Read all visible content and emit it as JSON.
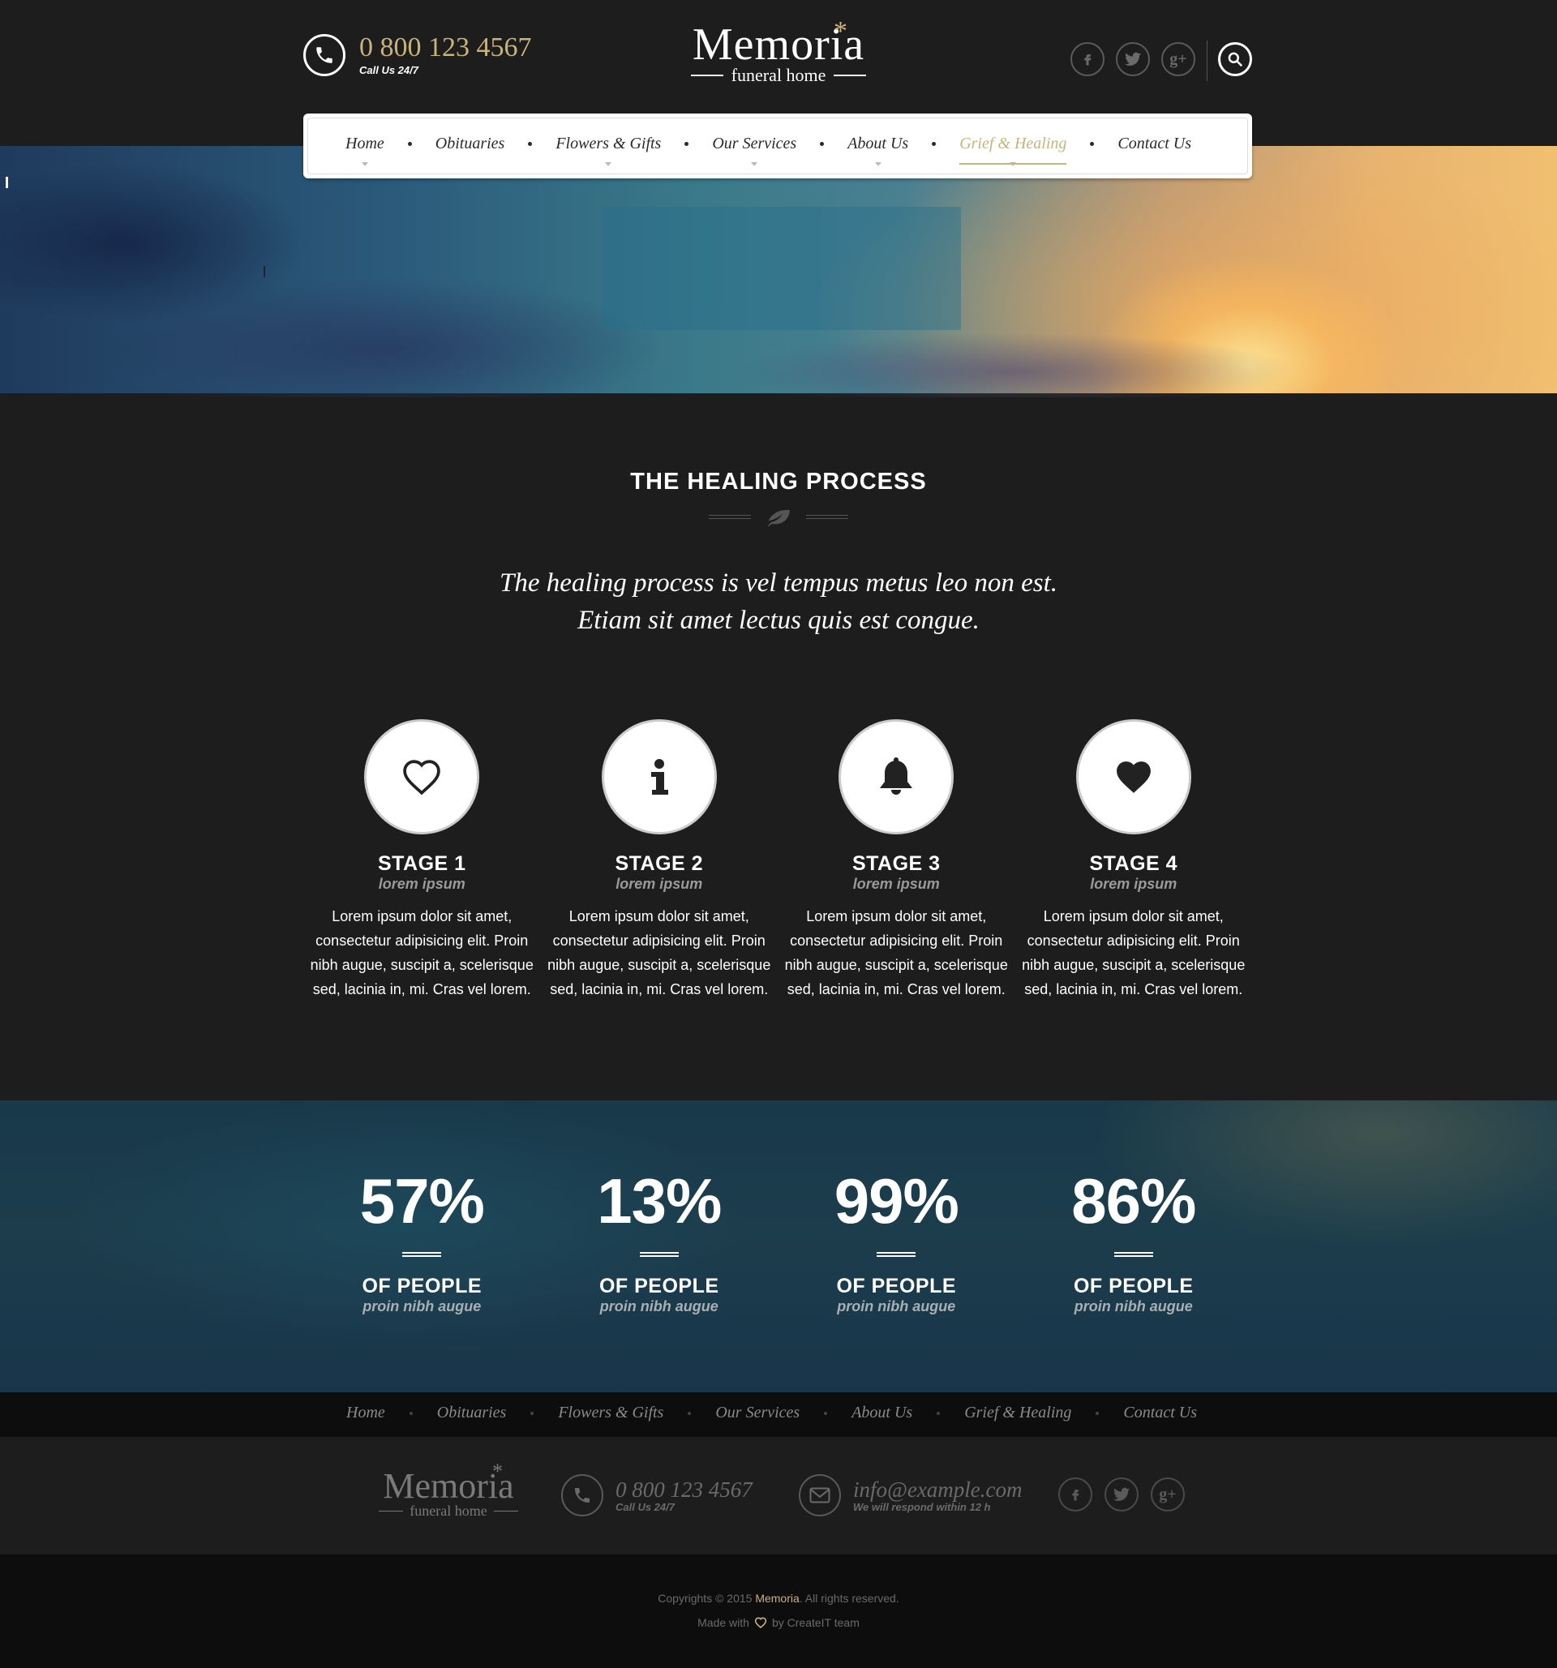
{
  "header": {
    "phone": "0 800 123 4567",
    "phone_sub": "Call Us 24/7",
    "logo_name": "Memoria",
    "logo_sub": "funeral home",
    "accent_color": "#c8b37b",
    "social": [
      {
        "icon": "facebook-icon",
        "glyph": "f"
      },
      {
        "icon": "twitter-icon",
        "glyph": "t"
      },
      {
        "icon": "google-plus-icon",
        "glyph": "g+"
      }
    ]
  },
  "nav": {
    "items": [
      {
        "label": "Home",
        "dropdown": true,
        "active": false
      },
      {
        "label": "Obituaries",
        "dropdown": false,
        "active": false
      },
      {
        "label": "Flowers & Gifts",
        "dropdown": true,
        "active": false
      },
      {
        "label": "Our Services",
        "dropdown": true,
        "active": false
      },
      {
        "label": "About Us",
        "dropdown": true,
        "active": false
      },
      {
        "label": "Grief & Healing",
        "dropdown": true,
        "active": true
      },
      {
        "label": "Contact Us",
        "dropdown": false,
        "active": false
      }
    ]
  },
  "healing": {
    "title": "THE HEALING PROCESS",
    "quote_line1": "The healing process is vel tempus metus leo non est.",
    "quote_line2": "Etiam sit amet lectus quis est congue.",
    "stages": [
      {
        "icon": "heart-outline-icon",
        "title": "STAGE 1",
        "sub": "lorem ipsum",
        "text": "Lorem ipsum dolor sit amet, consectetur adipisicing elit. Proin nibh augue, suscipit a, scelerisque sed, lacinia in, mi. Cras vel lorem."
      },
      {
        "icon": "info-icon",
        "title": "STAGE 2",
        "sub": "lorem ipsum",
        "text": "Lorem ipsum dolor sit amet, consectetur adipisicing elit. Proin nibh augue, suscipit a, scelerisque sed, lacinia in, mi. Cras vel lorem."
      },
      {
        "icon": "bell-icon",
        "title": "STAGE 3",
        "sub": "lorem ipsum",
        "text": "Lorem ipsum dolor sit amet, consectetur adipisicing elit. Proin nibh augue, suscipit a, scelerisque sed, lacinia in, mi. Cras vel lorem."
      },
      {
        "icon": "heart-filled-icon",
        "title": "STAGE 4",
        "sub": "lorem ipsum",
        "text": "Lorem ipsum dolor sit amet, consectetur adipisicing elit. Proin nibh augue, suscipit a, scelerisque sed, lacinia in, mi. Cras vel lorem."
      }
    ]
  },
  "stats": [
    {
      "value": "57%",
      "label": "OF PEOPLE",
      "sub": "proin nibh augue"
    },
    {
      "value": "13%",
      "label": "OF PEOPLE",
      "sub": "proin nibh augue"
    },
    {
      "value": "99%",
      "label": "OF PEOPLE",
      "sub": "proin nibh augue"
    },
    {
      "value": "86%",
      "label": "OF PEOPLE",
      "sub": "proin nibh augue"
    }
  ],
  "footer": {
    "nav": [
      "Home",
      "Obituaries",
      "Flowers & Gifts",
      "Our Services",
      "About Us",
      "Grief & Healing",
      "Contact Us"
    ],
    "logo_name": "Memoria",
    "logo_sub": "funeral home",
    "phone": "0 800 123 4567",
    "phone_sub": "Call Us 24/7",
    "email": "info@example.com",
    "email_sub": "We will respond within 12 h",
    "copyright_prefix": "Copyrights © 2015 ",
    "copyright_brand": "Memoria",
    "copyright_suffix": ". All rights reserved.",
    "made_with_prefix": "Made with",
    "made_with_suffix": "by CreateIT team"
  }
}
